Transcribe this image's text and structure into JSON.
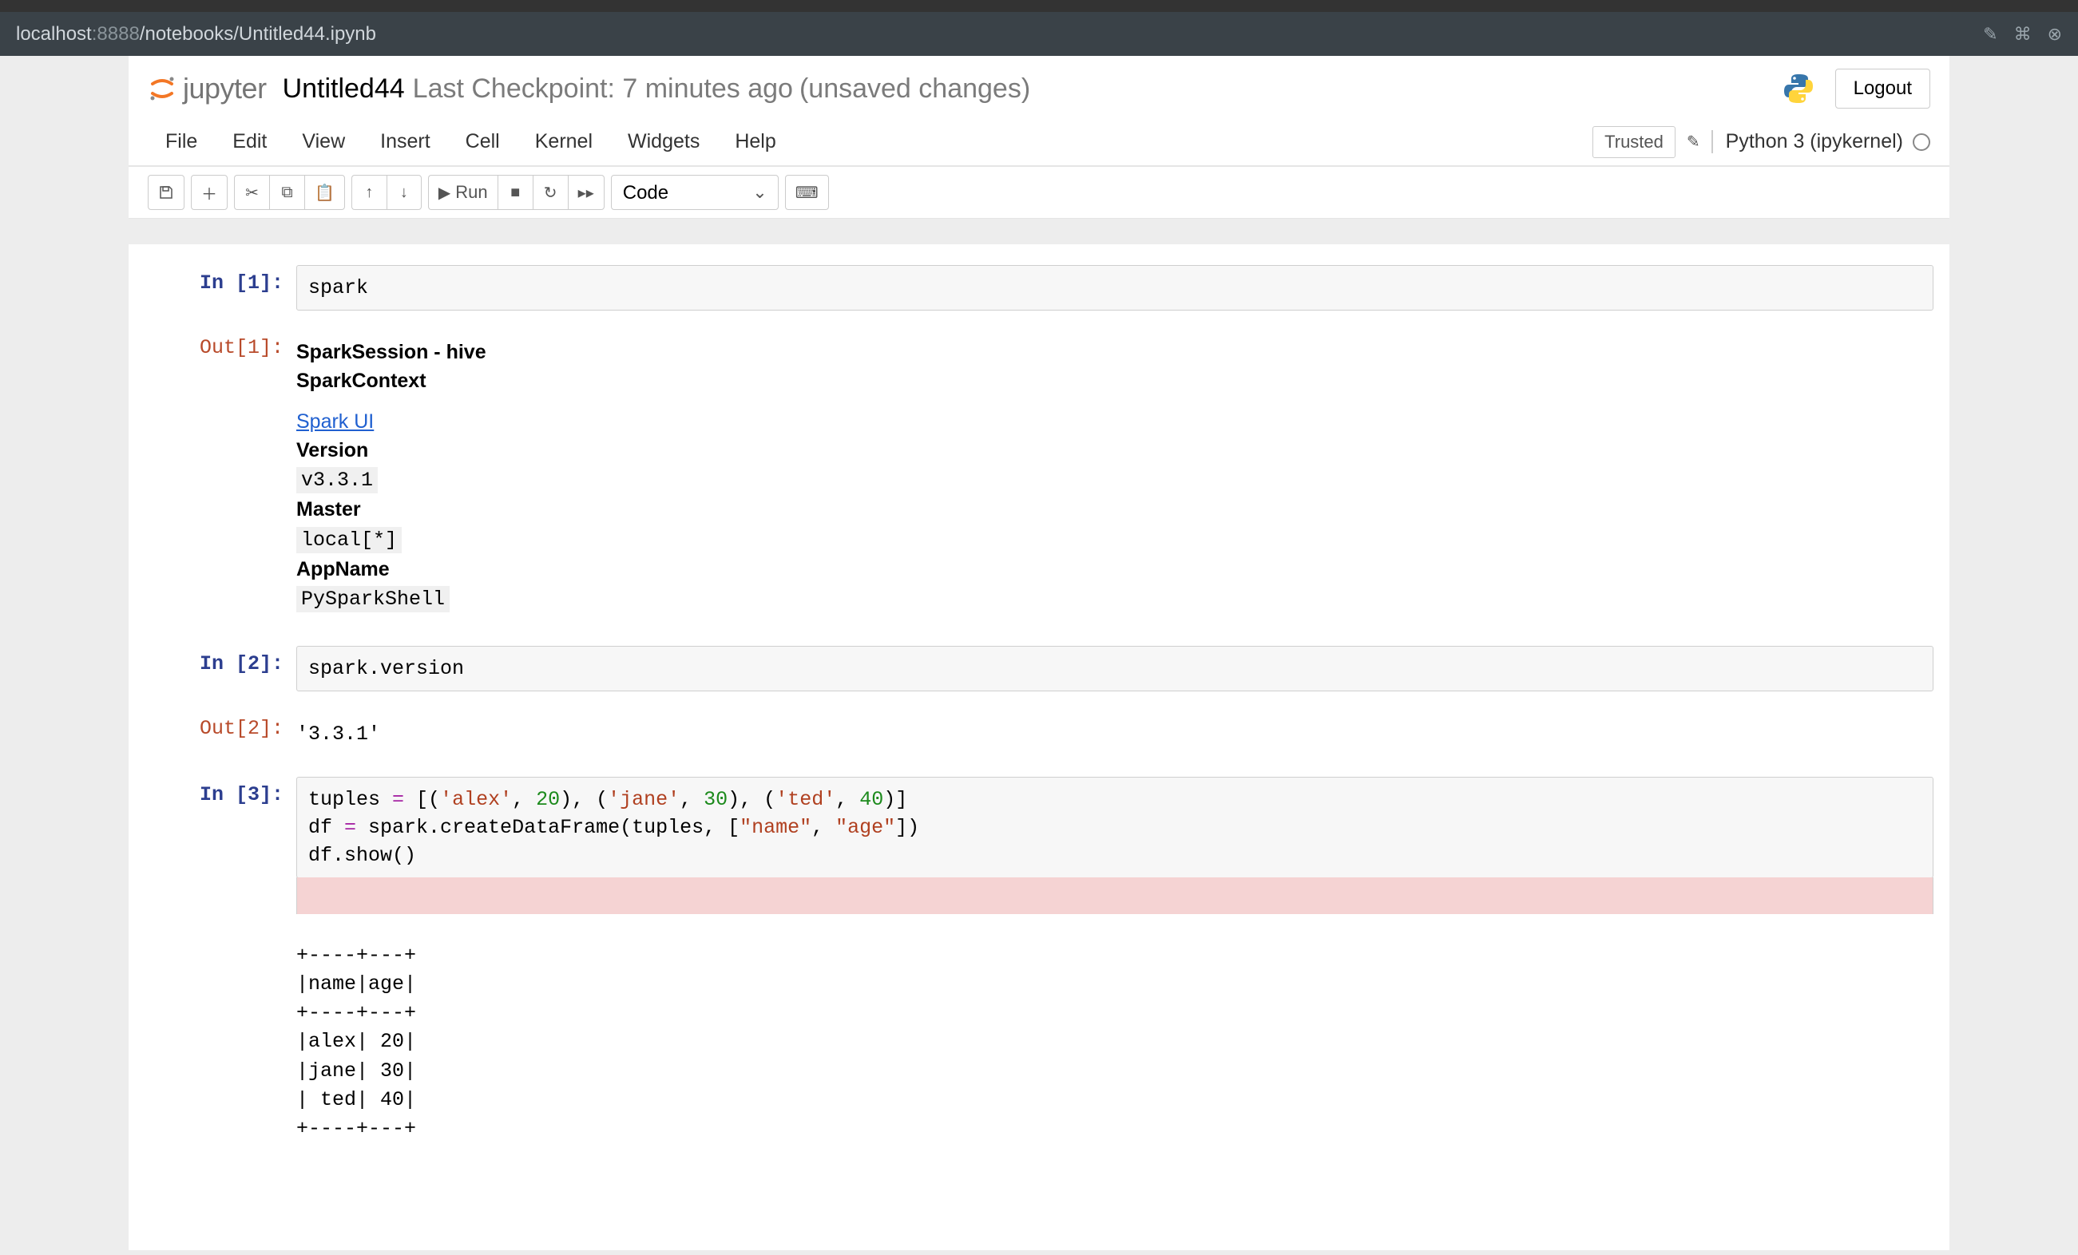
{
  "browser": {
    "url_host": "localhost",
    "url_port": ":8888",
    "url_path": "/notebooks/Untitled44.ipynb"
  },
  "header": {
    "logo_text": "jupyter",
    "notebook_name": "Untitled44",
    "checkpoint": "Last Checkpoint: 7 minutes ago",
    "unsaved": "(unsaved changes)",
    "logout": "Logout"
  },
  "menubar": {
    "items": [
      "File",
      "Edit",
      "View",
      "Insert",
      "Cell",
      "Kernel",
      "Widgets",
      "Help"
    ],
    "trusted": "Trusted",
    "kernel_name": "Python 3 (ipykernel)"
  },
  "toolbar": {
    "run_label": "Run",
    "cell_type": "Code"
  },
  "cells": [
    {
      "in_prompt": "In [1]:",
      "code_plain": "spark",
      "out_prompt": "Out[1]:",
      "output_html": {
        "title1": "SparkSession - hive",
        "title2": "SparkContext",
        "link": "Spark UI",
        "version_label": "Version",
        "version_value": "v3.3.1",
        "master_label": "Master",
        "master_value": "local[*]",
        "appname_label": "AppName",
        "appname_value": "PySparkShell"
      }
    },
    {
      "in_prompt": "In [2]:",
      "code_plain": "spark.version",
      "out_prompt": "Out[2]:",
      "output_text": "'3.3.1'"
    },
    {
      "in_prompt": "In [3]:",
      "code_tokens": [
        {
          "t": "tuples ",
          "c": ""
        },
        {
          "t": "=",
          "c": "op"
        },
        {
          "t": " [(",
          "c": ""
        },
        {
          "t": "'alex'",
          "c": "str"
        },
        {
          "t": ", ",
          "c": ""
        },
        {
          "t": "20",
          "c": "num"
        },
        {
          "t": "), (",
          "c": ""
        },
        {
          "t": "'jane'",
          "c": "str"
        },
        {
          "t": ", ",
          "c": ""
        },
        {
          "t": "30",
          "c": "num"
        },
        {
          "t": "), (",
          "c": ""
        },
        {
          "t": "'ted'",
          "c": "str"
        },
        {
          "t": ", ",
          "c": ""
        },
        {
          "t": "40",
          "c": "num"
        },
        {
          "t": ")]\n",
          "c": ""
        },
        {
          "t": "df ",
          "c": ""
        },
        {
          "t": "=",
          "c": "op"
        },
        {
          "t": " spark.createDataFrame(tuples, [",
          "c": ""
        },
        {
          "t": "\"name\"",
          "c": "str"
        },
        {
          "t": ", ",
          "c": ""
        },
        {
          "t": "\"age\"",
          "c": "str"
        },
        {
          "t": "])\n",
          "c": ""
        },
        {
          "t": "df.show()",
          "c": ""
        }
      ],
      "stdout": "+----+---+\n|name|age|\n+----+---+\n|alex| 20|\n|jane| 30|\n| ted| 40|\n+----+---+"
    }
  ]
}
